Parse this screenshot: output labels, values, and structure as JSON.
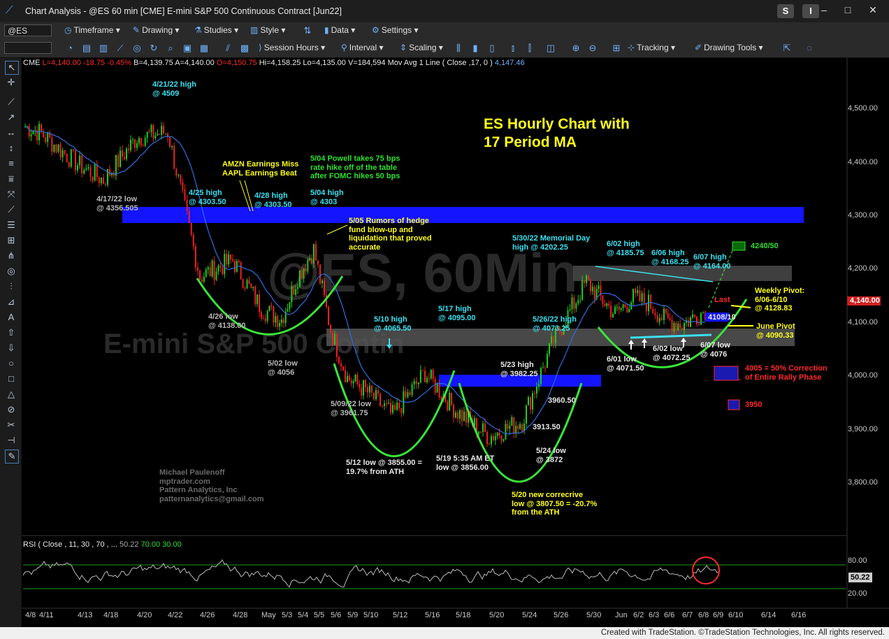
{
  "window": {
    "title": "Chart Analysis - @ES 60 min [CME] E-mini S&P 500 Continuous Contract [Jun22]",
    "s_button": "S",
    "i_button": "I",
    "controls": [
      "–",
      "□",
      "✕"
    ]
  },
  "toolbar1": {
    "symbol": "@ES",
    "items": [
      "Timeframe",
      "Drawing",
      "Studies",
      "Style",
      "Data",
      "Settings"
    ]
  },
  "toolbar2": {
    "items": [
      "Session Hours",
      "Interval",
      "Scaling",
      "Tracking",
      "Drawing Tools"
    ]
  },
  "info": {
    "exchange": "CME",
    "last": "L=4,140.00",
    "chg": "-18.75",
    "pct": "-0.45%",
    "bid": "B=4,139.75",
    "ask": "A=4,140.00",
    "open": "O=4,150.75",
    "hi": "Hi=4,158.25",
    "lo": "Lo=4,135.00",
    "vol": "V=184,594",
    "ma_label": "Mov Avg 1 Line  ( Close ,17,  0 )",
    "ma_value": "4,147.46"
  },
  "chart_title": "ES Hourly Chart with\n17 Period MA",
  "watermark": {
    "symbol": "@ES, 60Min",
    "name": "E-mini S&P 500 Contin"
  },
  "credits": "Michael Paulenoff\nmptrader.com\nPattern Analytics, Inc\npatternanalytics@gmail.com",
  "price_axis": [
    "4,500.00",
    "4,400.00",
    "4,300.00",
    "4,200.00",
    "4,100.00",
    "4,000.00",
    "3,900.00",
    "3,800.00"
  ],
  "price_tag": "4,140.00",
  "date_axis": [
    "4/8",
    "4/11",
    "4/13",
    "4/18",
    "4/20",
    "4/22",
    "4/26",
    "4/28",
    "May",
    "5/3",
    "5/4",
    "5/5",
    "5/6",
    "5/9",
    "5/10",
    "5/12",
    "5/16",
    "5/18",
    "5/20",
    "5/24",
    "5/26",
    "5/30",
    "Jun",
    "6/2",
    "6/3",
    "6/6",
    "6/7",
    "6/8",
    "6/9",
    "6/10",
    "6/14",
    "6/16"
  ],
  "annotations": {
    "a1": "4/21/22 high\n@ 4509",
    "a2": "4/17/22 low\n@ 4356.505",
    "a3": "AMZN Earnings Miss\nAAPL Earnings Beat",
    "a4": "5/04 Powell takes 75 bps\nrate hike off of the table\nafter FOMC hikes 50 bps",
    "a5": "4/25 high\n@ 4303.50",
    "a6": "4/28 high\n@ 4303.50",
    "a7": "5/04 high\n@ 4303",
    "a8": "5/05 Rumors of hedge\nfund blow-up and\nliquidation that proved\naccurate",
    "a9": "4/26 low\n@ 4138.00",
    "a10": "5/02 low\n@ 4056",
    "a11": "5/10 high\n@ 4065.50",
    "a12": "5/17 high\n@ 4095.00",
    "a13": "5/26/22 high\n@ 4073.25",
    "a14": "5/30/22 Memorial Day\nhigh @ 4202.25",
    "a15": "6/02 high\n@ 4185.75",
    "a16": "6/06 high\n@ 4168.25",
    "a17": "6/07 high\n@ 4164.00",
    "a18": "5/09/22 low\n@ 3961.75",
    "a19": "5/23 high\n@ 3982.25",
    "a20": "3960.50",
    "a21": "3913.50",
    "a22": "5/24 low\n@ 3872",
    "a23": "5/12 low @ 3855.00 =\n19.7% from ATH",
    "a24": "5/19 5:35 AM ET\nlow @ 3856.00",
    "a25": "5/20 new correcrive\nlow @ 3807.50 = -20.7%\nfrom the ATH",
    "a26": "6/01 low\n@ 4071.50",
    "a27": "6/02 low\n@ 4072.25",
    "a28": "6/07 low\n@ 4076",
    "a29": "Weekly Pivot:\n6/06-6/10\n@ 4128.83",
    "a30": "June Pivot\n@ 4090.33",
    "a31": "4240/50",
    "a32": "Last",
    "a33": "4108/10",
    "a34": "4005 = 50% Correction\nof Entire Rally Phase",
    "a35": "3950"
  },
  "rsi": {
    "label": "RSI  ( Close , 11,  30 , 70 , ...",
    "value": "50.22",
    "ob": "70.00",
    "os": "30.00",
    "axis": [
      "80.00",
      "20.00"
    ],
    "tag": "50.22"
  },
  "status": "Created with TradeStation. ©TradeStation Technologies, Inc. All rights reserved.",
  "chart_data": {
    "type": "line",
    "title": "ES Hourly Chart with 17 Period MA",
    "x": [
      "4/8",
      "4/11",
      "4/13",
      "4/18",
      "4/20",
      "4/22",
      "4/26",
      "4/28",
      "May",
      "5/3",
      "5/4",
      "5/5",
      "5/6",
      "5/9",
      "5/10",
      "5/12",
      "5/16",
      "5/18",
      "5/20",
      "5/24",
      "5/26",
      "5/30",
      "Jun",
      "6/2",
      "6/3",
      "6/6",
      "6/7",
      "6/8"
    ],
    "series": [
      {
        "values": [
          4480,
          4470,
          4410,
          4380,
          4460,
          4470,
          4200,
          4230,
          4140,
          4120,
          4200,
          4250,
          4100,
          4010,
          3990,
          3940,
          4020,
          3950,
          3900,
          3930,
          4080,
          4190,
          4130,
          4160,
          4150,
          4120,
          4110,
          4140
        ]
      }
    ],
    "ylim": [
      3760,
      4560
    ],
    "key_points": [
      {
        "x": "4/21",
        "y": 4509
      },
      {
        "x": "5/12",
        "y": 3855
      },
      {
        "x": "5/20",
        "y": 3807.5
      },
      {
        "x": "5/30",
        "y": 4202.25
      },
      {
        "x": "6/8",
        "y": 4140
      }
    ],
    "levels": [
      4303,
      4202.25,
      4128.83,
      4090.33,
      4065.5,
      3982.25,
      4005,
      3950,
      4245,
      4109
    ]
  }
}
